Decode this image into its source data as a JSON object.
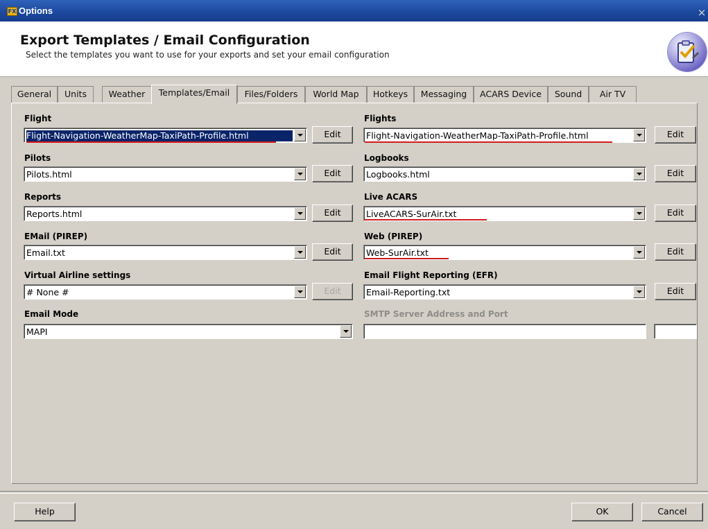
{
  "window": {
    "title": "Options",
    "app_icon": "fsx-app-icon",
    "close_glyph": "×"
  },
  "header": {
    "title": "Export Templates / Email Configuration",
    "subtitle": "Select the templates you want to use for your exports and set your email configuration",
    "icon": "checklist-badge-icon"
  },
  "tabs": [
    {
      "label": "General",
      "active": false
    },
    {
      "label": "Units",
      "active": false
    },
    {
      "label": "Weather",
      "active": false
    },
    {
      "label": "Templates/Email",
      "active": true
    },
    {
      "label": "Files/Folders",
      "active": false
    },
    {
      "label": "World Map",
      "active": false
    },
    {
      "label": "Hotkeys",
      "active": false
    },
    {
      "label": "Messaging",
      "active": false
    },
    {
      "label": "ACARS Device",
      "active": false
    },
    {
      "label": "Sound",
      "active": false
    },
    {
      "label": "Air TV",
      "active": false
    }
  ],
  "left_fields": {
    "flight": {
      "label": "Flight",
      "value": "Flight-Navigation-WeatherMap-TaxiPath-Profile.html",
      "edit": "Edit"
    },
    "pilots": {
      "label": "Pilots",
      "value": "Pilots.html",
      "edit": "Edit"
    },
    "reports": {
      "label": "Reports",
      "value": "Reports.html",
      "edit": "Edit"
    },
    "email": {
      "label": "EMail (PIREP)",
      "value": "Email.txt",
      "edit": "Edit"
    },
    "va": {
      "label": "Virtual Airline settings",
      "value": "# None #",
      "edit": "Edit"
    },
    "mode": {
      "label": "Email Mode",
      "value": "MAPI"
    }
  },
  "right_fields": {
    "flights": {
      "label": "Flights",
      "value": "Flight-Navigation-WeatherMap-TaxiPath-Profile.html",
      "edit": "Edit"
    },
    "logbooks": {
      "label": "Logbooks",
      "value": "Logbooks.html",
      "edit": "Edit"
    },
    "acars": {
      "label": "Live ACARS",
      "value": "LiveACARS-SurAir.txt",
      "edit": "Edit"
    },
    "web": {
      "label": "Web (PIREP)",
      "value": "Web-SurAir.txt",
      "edit": "Edit"
    },
    "efr": {
      "label": "Email Flight Reporting (EFR)",
      "value": "Email-Reporting.txt",
      "edit": "Edit"
    },
    "smtp": {
      "label": "SMTP Server Address and Port",
      "address": "",
      "port": ""
    }
  },
  "footer": {
    "help": "Help",
    "ok": "OK",
    "cancel": "Cancel"
  },
  "colors": {
    "title_bar": "#1d4aa0",
    "dialog_bg": "#d4d0c8",
    "selection": "#0a246a",
    "annotation_red": "#d31b1b"
  }
}
